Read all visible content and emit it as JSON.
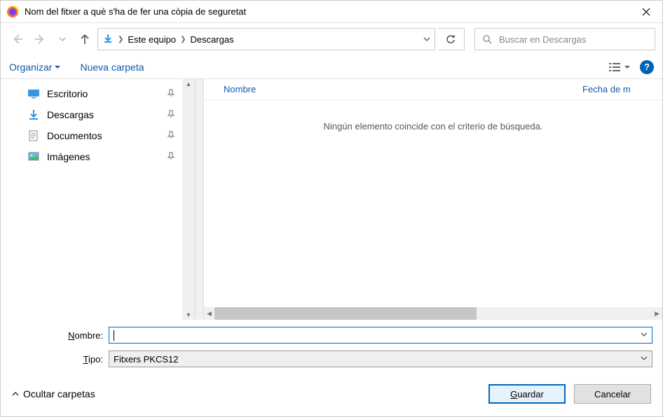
{
  "title": "Nom del fitxer a què s'ha de fer una còpia de seguretat",
  "breadcrumb": {
    "root": "Este equipo",
    "current": "Descargas"
  },
  "search": {
    "placeholder": "Buscar en Descargas"
  },
  "toolbar": {
    "organize": "Organizar",
    "newfolder": "Nueva carpeta"
  },
  "quick_access": [
    {
      "label": "Escritorio"
    },
    {
      "label": "Descargas"
    },
    {
      "label": "Documentos"
    },
    {
      "label": "Imágenes"
    }
  ],
  "columns": {
    "name": "Nombre",
    "date_partial": "Fecha de m"
  },
  "empty_message": "Ningún elemento coincide con el criterio de búsqueda.",
  "form": {
    "name_label_pre": "N",
    "name_label_rest": "ombre:",
    "type_label_pre": "T",
    "type_label_rest": "ipo:",
    "name_value": "",
    "type_value": "Fitxers PKCS12"
  },
  "footer": {
    "hide": "Ocultar carpetas",
    "save_pre": "G",
    "save_rest": "uardar",
    "cancel": "Cancelar"
  }
}
